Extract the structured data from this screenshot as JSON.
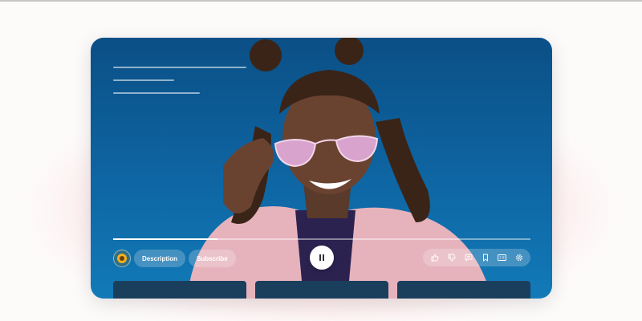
{
  "controls": {
    "description_label": "Description",
    "subscribe_label": "Subscribe"
  },
  "playback": {
    "progress_fraction": 0.25
  },
  "icons": {
    "avatar": "sunflower-avatar-icon",
    "play_pause": "pause-icon",
    "right_group": [
      "like-icon",
      "dislike-icon",
      "comment-icon",
      "bookmark-icon",
      "captions-icon",
      "settings-icon"
    ]
  },
  "colors": {
    "player_background": "#0e66a3",
    "glow": "#ffb0b8",
    "pill_background": "rgba(255,255,255,0.22)",
    "card_background": "#1a3f5c"
  }
}
